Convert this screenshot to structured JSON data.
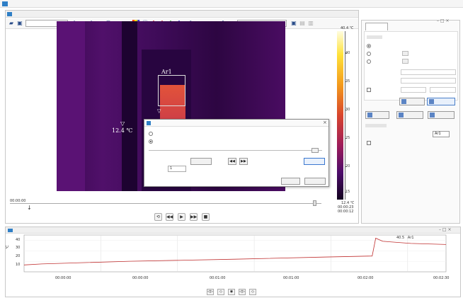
{
  "window": {
    "title": "",
    "document_title": ""
  },
  "toolbar": {
    "palette_select": "",
    "zoom_select": ""
  },
  "thermal": {
    "roi_label": "Ar1",
    "point_temp": "12.4 ℃",
    "point_marker": "▽",
    "roi_marker": "▽"
  },
  "colorbar": {
    "max": "40.4 ℃",
    "min": "12.4 ℃",
    "ticks": [
      "40",
      "35",
      "30",
      "25",
      "20",
      "15"
    ],
    "top_color": "#fffde0",
    "bottom_color": "#12021e"
  },
  "timeline": {
    "start": "00:00:00",
    "end_current": "00:00:23",
    "end_total": "00:00:12"
  },
  "playback": {
    "buttons": [
      "⟲",
      "◀◀",
      "▶",
      "▶▶",
      "■"
    ]
  },
  "right_panel": {
    "tab": "",
    "palette_radio_1": "",
    "palette_radio_2": "",
    "palette_radio_3": "",
    "label_a": "",
    "label_b": "",
    "check_label": "",
    "save_button": "",
    "apply_button": "",
    "btn_1": "",
    "btn_2": "",
    "btn_3": "",
    "field_label": "",
    "field_value": "Ar1",
    "check2_label": "",
    "label_c": "",
    "label_c_value": ""
  },
  "dialog": {
    "title": "",
    "radio_none": "",
    "radio_custom": "",
    "start_label": "",
    "start_value": "",
    "set_button": "",
    "end_label": "",
    "end_value": "",
    "set_button_2": "",
    "interval_label": "",
    "interval_value": "1",
    "interval_unit": "",
    "ok_button": "",
    "cancel_button": "",
    "close": "×",
    "prev_button": "◀◀",
    "next_button": "▶▶"
  },
  "graph": {
    "window_title": "",
    "y_ticks": [
      "40",
      "30",
      "20",
      "10"
    ],
    "y_unit": "℃",
    "x_ticks": [
      "00:00:00",
      "00:00:00",
      "00:01:00",
      "00:01:00",
      "00:02:00",
      "00:02:30"
    ],
    "x_label": "",
    "legend_time": "",
    "legend_value": "40.5",
    "legend_series": "Ar1",
    "legend_extra": "",
    "line_color": "#c03030",
    "window_controls": "– □ ×",
    "bottom_buttons": [
      "◁▷",
      "◇",
      "◉",
      "◁▷",
      "◇"
    ]
  },
  "chart_data": {
    "type": "line",
    "series": [
      {
        "name": "Ar1",
        "x": [
          0,
          0.05,
          0.3,
          0.6,
          0.85,
          0.99,
          1.0,
          1.02,
          1.1,
          1.2
        ],
        "values": [
          16.5,
          17.5,
          20,
          22,
          24,
          25,
          42,
          39,
          37,
          36
        ]
      }
    ],
    "ylim": [
      10,
      45
    ],
    "grid": true
  }
}
